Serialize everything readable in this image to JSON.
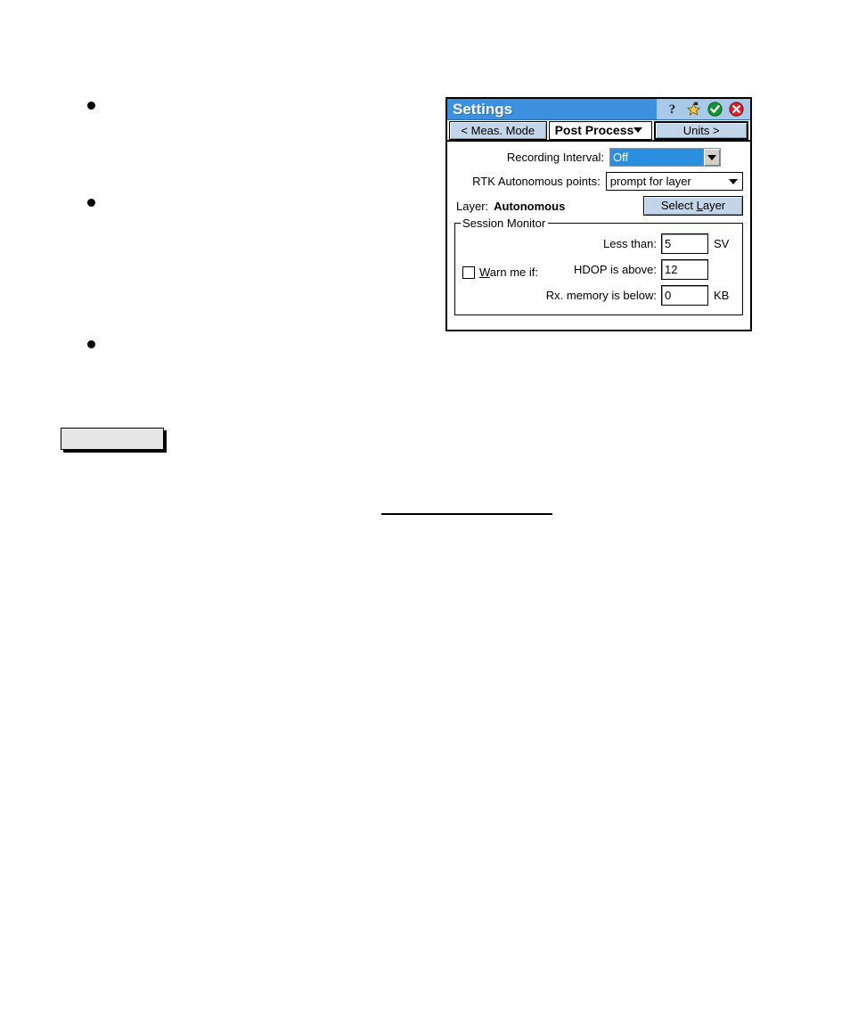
{
  "document": {
    "bullets": [
      "",
      "",
      ""
    ],
    "placeholder_box_label": "",
    "divider": ""
  },
  "settings_window": {
    "titlebar": {
      "title": "Settings",
      "icons": [
        {
          "name": "help-icon",
          "glyph": "?"
        },
        {
          "name": "favorites-star-icon",
          "glyph": "star"
        },
        {
          "name": "ok-check-icon",
          "glyph": "check"
        },
        {
          "name": "close-x-icon",
          "glyph": "x"
        }
      ],
      "bg_color": "#3d90dd",
      "icon_bar_color": "#a9c9e9"
    },
    "navbar": {
      "prev_label": "< Meas. Mode",
      "page_select_value": "Post Process",
      "next_label": "Units >"
    },
    "fields": {
      "recording_interval": {
        "label": "Recording Interval:",
        "value": "Off",
        "selected": true,
        "highlight_color": "#2a8fe0"
      },
      "rtk_autonomous_points": {
        "label": "RTK Autonomous points:",
        "value": "prompt for layer"
      },
      "layer": {
        "label": "Layer:",
        "value": "Autonomous",
        "button_label_pre": "Select ",
        "button_label_mnemonic": "L",
        "button_label_post": "ayer"
      }
    },
    "session_monitor": {
      "title": "Session Monitor",
      "checkbox": {
        "label_pre": "",
        "label_mnemonic": "W",
        "label_post": "arn me if:",
        "checked": false
      },
      "rows": [
        {
          "label": "Less than:",
          "value": "5",
          "unit": "SV"
        },
        {
          "label": "HDOP is above:",
          "value": "12",
          "unit": ""
        },
        {
          "label": "Rx. memory is below:",
          "value": "0",
          "unit": "KB"
        }
      ]
    }
  }
}
